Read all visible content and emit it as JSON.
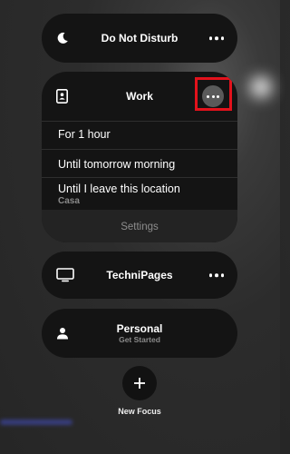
{
  "focus_modes": {
    "do_not_disturb": {
      "label": "Do Not Disturb",
      "icon": "moon-icon"
    },
    "work": {
      "label": "Work",
      "icon": "id-badge-icon",
      "options": {
        "opt1": "For 1 hour",
        "opt2": "Until tomorrow morning",
        "opt3": "Until I leave this location",
        "opt3_sub": "Casa"
      },
      "settings_label": "Settings",
      "highlight_color": "#e3121c"
    },
    "technipages": {
      "label": "TechniPages",
      "icon": "monitor-icon"
    },
    "personal": {
      "label": "Personal",
      "subtitle": "Get Started",
      "icon": "person-icon"
    }
  },
  "new_focus": {
    "label": "New Focus",
    "icon": "plus-icon"
  }
}
